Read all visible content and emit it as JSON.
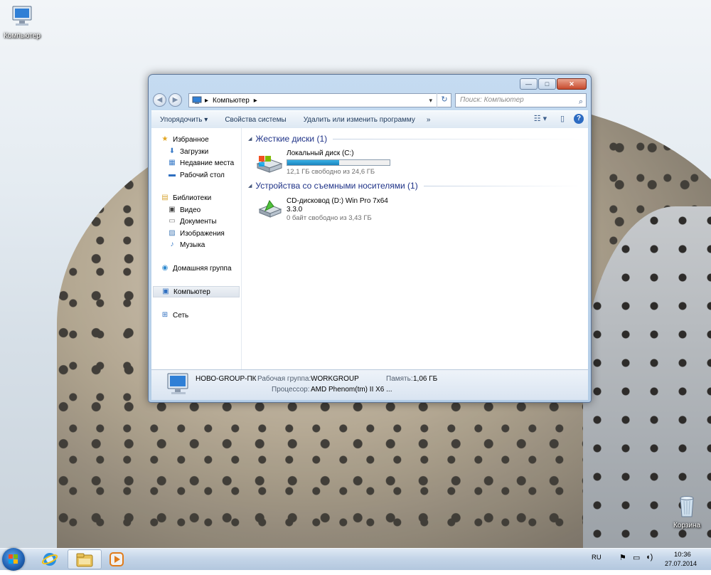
{
  "desktop": {
    "icons": [
      {
        "label": "Компьютер"
      },
      {
        "label": "Корзина"
      }
    ]
  },
  "window": {
    "title_buttons": {
      "minimize": "—",
      "maximize": "□",
      "close": "✕"
    },
    "nav": {
      "back": "◀",
      "forward": "▶"
    },
    "address": {
      "root_arrow": "▸",
      "location": "Компьютер",
      "sep_arrow": "▸",
      "dropdown": "▾",
      "refresh": "↻"
    },
    "search": {
      "placeholder": "Поиск: Компьютер",
      "icon": "⌕"
    },
    "toolbar": {
      "organize": "Упорядочить ▾",
      "system_properties": "Свойства системы",
      "uninstall": "Удалить или изменить программу",
      "more": "»",
      "view_icon": "☷ ▾",
      "preview_icon": "▯",
      "help_icon": "?"
    },
    "navpane": {
      "favorites": "Избранное",
      "downloads": "Загрузки",
      "recent": "Недавние места",
      "desktop": "Рабочий стол",
      "libraries": "Библиотеки",
      "video": "Видео",
      "documents": "Документы",
      "images": "Изображения",
      "music": "Музыка",
      "homegroup": "Домашняя группа",
      "computer": "Компьютер",
      "network": "Сеть"
    },
    "groups": {
      "hdd": {
        "title": "Жесткие диски (1)",
        "drive": {
          "name": "Локальный диск (C:)",
          "free": "12,1 ГБ свободно из 24,6 ГБ",
          "used_fraction": 0.51
        }
      },
      "removable": {
        "title": "Устройства со съемными носителями (1)",
        "drive": {
          "name": "CD-дисковод (D:) Win Pro 7x64",
          "version": "3.3.0",
          "free": "0 байт свободно из 3,43 ГБ"
        }
      }
    },
    "details": {
      "pc_name": "НОВО-GROUP-ПК",
      "workgroup_label": "Рабочая группа:",
      "workgroup_value": "WORKGROUP",
      "memory_label": "Память:",
      "memory_value": "1,06 ГБ",
      "cpu_label": "Процессор:",
      "cpu_value": "AMD Phenom(tm) II X6 ..."
    }
  },
  "taskbar": {
    "language": "RU",
    "time": "10:36",
    "date": "27.07.2014"
  },
  "colors": {
    "accent": "#1e3287",
    "disk_bar": "#1a83bd",
    "close_button": "#c74a2d"
  }
}
